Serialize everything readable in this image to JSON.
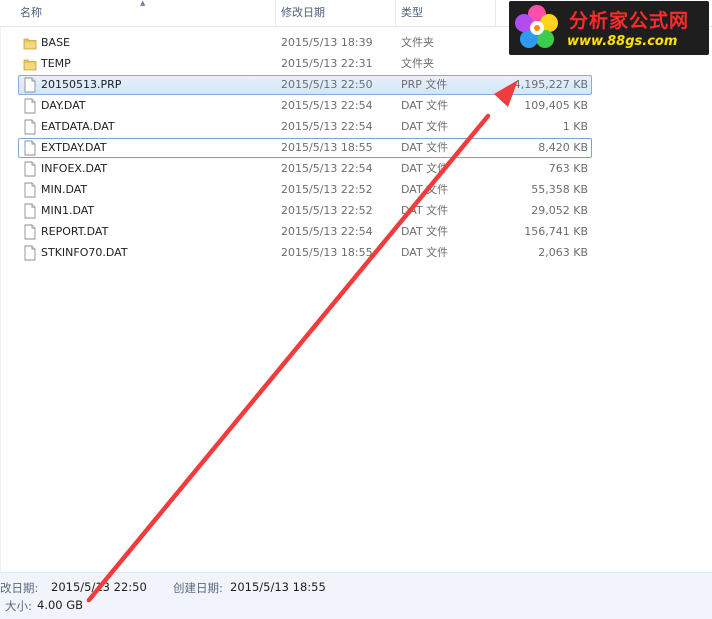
{
  "header": {
    "name_label": "名称",
    "date_label": "修改日期",
    "type_label": "类型"
  },
  "files": [
    {
      "name": "BASE",
      "date": "2015/5/13 18:39",
      "type": "文件夹",
      "size": "",
      "icon": "folder-icon",
      "state": "normal"
    },
    {
      "name": "TEMP",
      "date": "2015/5/13 22:31",
      "type": "文件夹",
      "size": "",
      "icon": "folder-icon",
      "state": "normal"
    },
    {
      "name": "20150513.PRP",
      "date": "2015/5/13 22:50",
      "type": "PRP 文件",
      "size": "4,195,227 KB",
      "icon": "file-icon",
      "state": "selected"
    },
    {
      "name": "DAY.DAT",
      "date": "2015/5/13 22:54",
      "type": "DAT 文件",
      "size": "109,405 KB",
      "icon": "file-icon",
      "state": "normal"
    },
    {
      "name": "EATDATA.DAT",
      "date": "2015/5/13 22:54",
      "type": "DAT 文件",
      "size": "1 KB",
      "icon": "file-icon",
      "state": "normal"
    },
    {
      "name": "EXTDAY.DAT",
      "date": "2015/5/13 18:55",
      "type": "DAT 文件",
      "size": "8,420 KB",
      "icon": "file-icon",
      "state": "focused"
    },
    {
      "name": "INFOEX.DAT",
      "date": "2015/5/13 22:54",
      "type": "DAT 文件",
      "size": "763 KB",
      "icon": "file-icon",
      "state": "normal"
    },
    {
      "name": "MIN.DAT",
      "date": "2015/5/13 22:52",
      "type": "DAT 文件",
      "size": "55,358 KB",
      "icon": "file-icon",
      "state": "normal"
    },
    {
      "name": "MIN1.DAT",
      "date": "2015/5/13 22:52",
      "type": "DAT 文件",
      "size": "29,052 KB",
      "icon": "file-icon",
      "state": "normal"
    },
    {
      "name": "REPORT.DAT",
      "date": "2015/5/13 22:54",
      "type": "DAT 文件",
      "size": "156,741 KB",
      "icon": "file-icon",
      "state": "normal"
    },
    {
      "name": "STKINFO70.DAT",
      "date": "2015/5/13 18:55",
      "type": "DAT 文件",
      "size": "2,063 KB",
      "icon": "file-icon",
      "state": "normal"
    }
  ],
  "details": {
    "modified_label": "改日期:",
    "modified_value": "2015/5/13 22:50",
    "created_label": "创建日期:",
    "created_value": "2015/5/13 18:55",
    "size_label": "大小:",
    "size_value": "4.00 GB"
  },
  "watermark": {
    "title": "分析家公式网",
    "url": "www.88gs.com"
  },
  "colors": {
    "annotation_arrow": "#f03c3c",
    "selection_fill": "#d9eafc",
    "selection_border": "#84acdd",
    "folder": "#e8c35a",
    "status_bar": "#f1f5fb"
  }
}
